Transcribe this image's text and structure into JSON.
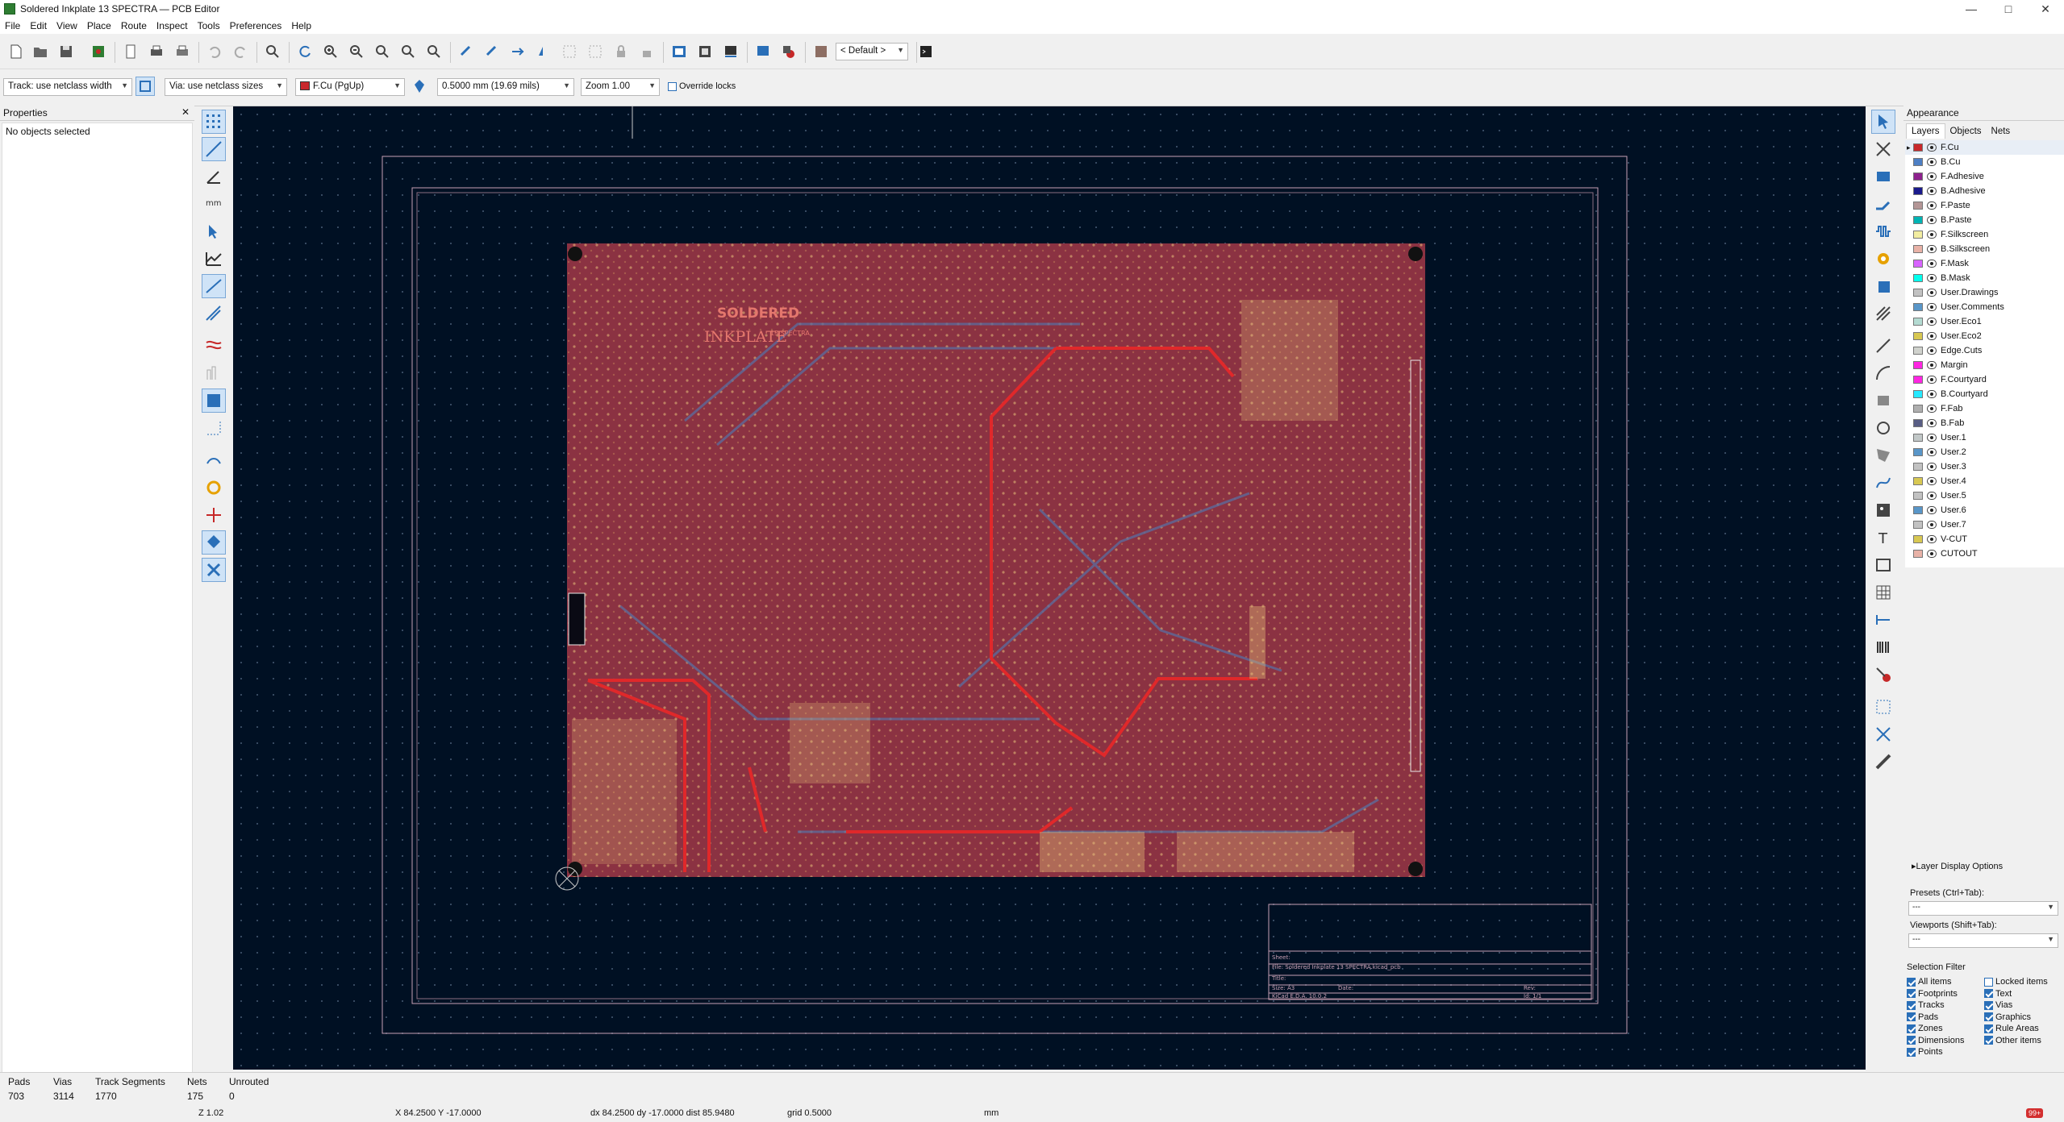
{
  "window": {
    "title": "Soldered Inkplate 13 SPECTRA — PCB Editor"
  },
  "menu": [
    "File",
    "Edit",
    "View",
    "Place",
    "Route",
    "Inspect",
    "Tools",
    "Preferences",
    "Help"
  ],
  "toolbar": {
    "preset": "< Default >"
  },
  "options": {
    "track": "Track: use netclass width",
    "via": "Via: use netclass sizes",
    "layer": "F.Cu (PgUp)",
    "layer_color": "#c8282c",
    "grid": "0.5000 mm (19.69 mils)",
    "zoom": "Zoom 1.00",
    "override_locks": "Override locks"
  },
  "properties": {
    "title": "Properties",
    "empty": "No objects selected"
  },
  "appearance": {
    "title": "Appearance",
    "tabs": [
      "Layers",
      "Objects",
      "Nets"
    ],
    "layers": [
      {
        "name": "F.Cu",
        "color": "#c8282c"
      },
      {
        "name": "B.Cu",
        "color": "#4d7fc4"
      },
      {
        "name": "F.Adhesive",
        "color": "#8d218d"
      },
      {
        "name": "B.Adhesive",
        "color": "#1a1a8c"
      },
      {
        "name": "F.Paste",
        "color": "#b49696"
      },
      {
        "name": "B.Paste",
        "color": "#00b4b4"
      },
      {
        "name": "F.Silkscreen",
        "color": "#f2eda1"
      },
      {
        "name": "B.Silkscreen",
        "color": "#e8b2a7"
      },
      {
        "name": "F.Mask",
        "color": "#d864ff"
      },
      {
        "name": "B.Mask",
        "color": "#02ffee"
      },
      {
        "name": "User.Drawings",
        "color": "#c2c2c2"
      },
      {
        "name": "User.Comments",
        "color": "#5996c8"
      },
      {
        "name": "User.Eco1",
        "color": "#b4dbd2"
      },
      {
        "name": "User.Eco2",
        "color": "#d8c852"
      },
      {
        "name": "Edge.Cuts",
        "color": "#d0d2cd"
      },
      {
        "name": "Margin",
        "color": "#ff26e2"
      },
      {
        "name": "F.Courtyard",
        "color": "#ff26e2"
      },
      {
        "name": "B.Courtyard",
        "color": "#26e9ff"
      },
      {
        "name": "F.Fab",
        "color": "#afafaf"
      },
      {
        "name": "B.Fab",
        "color": "#585d84"
      },
      {
        "name": "User.1",
        "color": "#c2c8c8"
      },
      {
        "name": "User.2",
        "color": "#5996c8"
      },
      {
        "name": "User.3",
        "color": "#c2c2c2"
      },
      {
        "name": "User.4",
        "color": "#d8c852"
      },
      {
        "name": "User.5",
        "color": "#c2c2c2"
      },
      {
        "name": "User.6",
        "color": "#5996c8"
      },
      {
        "name": "User.7",
        "color": "#c2c2c2"
      },
      {
        "name": "V-CUT",
        "color": "#d8c852"
      },
      {
        "name": "CUTOUT",
        "color": "#e8b2a7"
      }
    ],
    "layer_display_options": "Layer Display Options",
    "presets_label": "Presets (Ctrl+Tab):",
    "presets_value": "---",
    "viewports_label": "Viewports (Shift+Tab):",
    "viewports_value": "---",
    "selection_filter": "Selection Filter",
    "filters_left": [
      "All items",
      "Footprints",
      "Tracks",
      "Pads",
      "Zones",
      "Dimensions",
      "Points"
    ],
    "filters_right": [
      "Locked items",
      "Text",
      "Vias",
      "Graphics",
      "Rule Areas",
      "Other items"
    ]
  },
  "board": {
    "logo": "SOLDERED",
    "product": "INKPLATE",
    "product_sub": "13 SPECTRA",
    "tb_sheet": "Sheet:",
    "tb_file": "File: Soldered Inkplate 13 SPECTRA.kicad_pcb",
    "tb_title": "Title:",
    "tb_size": "Size: A3",
    "tb_date": "Date:",
    "tb_rev": "Rev:",
    "tb_kicad": "KiCad E.D.A. 10.0.2",
    "tb_id": "Id: 1/1"
  },
  "messages": {
    "headers": [
      "Pads",
      "Vias",
      "Track Segments",
      "Nets",
      "Unrouted"
    ],
    "values": [
      "703",
      "3114",
      "1770",
      "175",
      "0"
    ]
  },
  "status": {
    "zoom": "Z 1.02",
    "pos": "X 84.2500  Y -17.0000",
    "delta": "dx 84.2500  dy -17.0000  dist 85.9480",
    "grid": "grid 0.5000",
    "units": "mm",
    "badge": "99+"
  }
}
